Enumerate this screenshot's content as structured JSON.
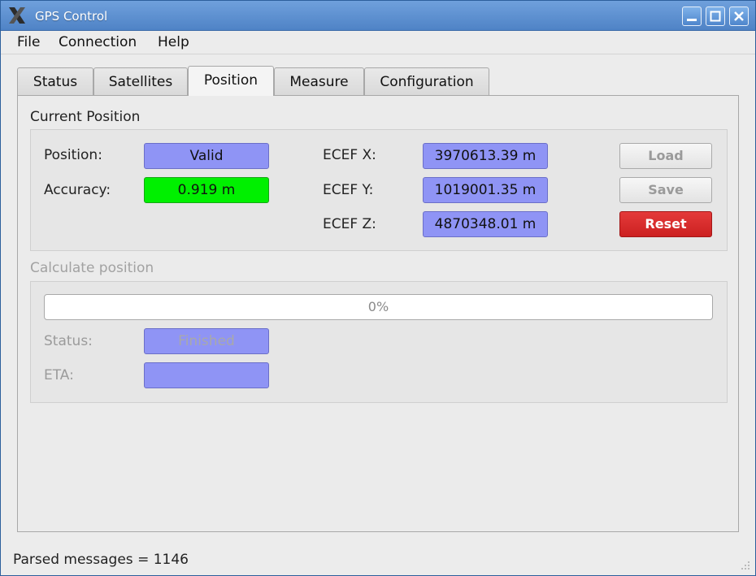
{
  "window": {
    "title": "GPS Control",
    "controls": [
      "minimize-icon",
      "maximize-icon",
      "close-icon"
    ]
  },
  "menu": {
    "file": "File",
    "connection": "Connection",
    "help": "Help"
  },
  "tabs": [
    {
      "label": "Status",
      "active": false
    },
    {
      "label": "Satellites",
      "active": false
    },
    {
      "label": "Position",
      "active": true
    },
    {
      "label": "Measure",
      "active": false
    },
    {
      "label": "Configuration",
      "active": false
    }
  ],
  "current_position": {
    "title": "Current Position",
    "position_label": "Position:",
    "position_value": "Valid",
    "accuracy_label": "Accuracy:",
    "accuracy_value": "0.919 m",
    "ecef_x_label": "ECEF X:",
    "ecef_x_value": "3970613.39 m",
    "ecef_y_label": "ECEF Y:",
    "ecef_y_value": "1019001.35 m",
    "ecef_z_label": "ECEF Z:",
    "ecef_z_value": "4870348.01 m",
    "load_label": "Load",
    "save_label": "Save",
    "reset_label": "Reset"
  },
  "calculate_position": {
    "title": "Calculate position",
    "progress_percent": 0,
    "progress_text": "0%",
    "status_label": "Status:",
    "status_value": "Finished",
    "eta_label": "ETA:",
    "eta_value": ""
  },
  "statusbar": {
    "text": "Parsed messages = 1146"
  },
  "colors": {
    "field_blue": "#8f94f5",
    "field_green": "#00f000",
    "reset_red": "#d92b2b",
    "titlebar_blue": "#5b8fd0"
  }
}
